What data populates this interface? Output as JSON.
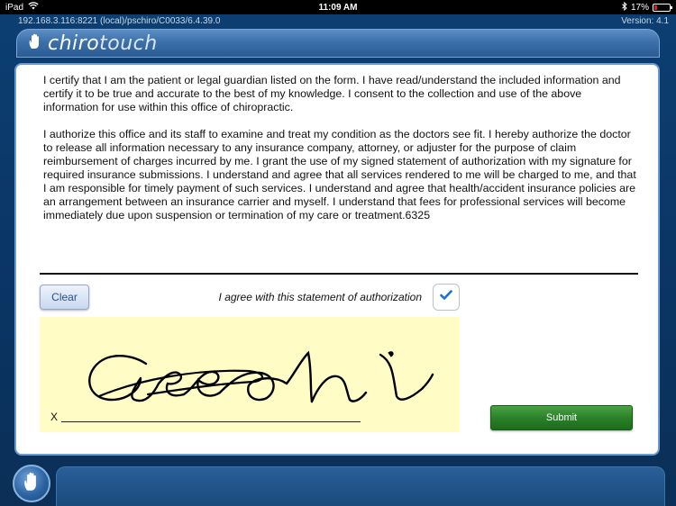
{
  "status_bar": {
    "device": "iPad",
    "time": "11:09 AM",
    "battery_percent": "17%",
    "battery_level": 0.17
  },
  "info_bar": {
    "server_path": "192.168.3.116:8221 (local)/pschiro/C0033/6.4.39.0",
    "version": "Version: 4.1"
  },
  "header": {
    "logo_chiro": "chiro",
    "logo_touch": "touch"
  },
  "statement": {
    "paragraph_1": "I certify that I am the patient or legal guardian listed on the form. I have read/understand the included information and certify it to be true and accurate to the best of my knowledge. I consent to the collection and use of the above information for use within this office of chiropractic.",
    "paragraph_2": "I authorize this office and its staff to examine and treat my condition as the doctors see fit. I hereby authorize the doctor to release all information necessary to any insurance company, attorney, or adjuster for the purpose of claim reimbursement of charges incurred by me. I grant the use of my signed statement of authorization with my signature for required insurance submissions. I understand and agree that all services rendered to me will be charged to me, and that I am responsible for timely payment of such services. I understand and agree that health/accident insurance policies are an arrangement between an insurance carrier and myself. I understand that fees for professional services will become immediately due upon suspension or termination of my care or treatment.6325"
  },
  "controls": {
    "clear_label": "Clear",
    "agree_label": "I agree with this statement of authorization",
    "agree_checked": true,
    "signature_x": "X",
    "submit_label": "Submit"
  },
  "colors": {
    "accent_blue": "#1a6fd8",
    "submit_green": "#2b8129",
    "signature_pad": "#fffcc6"
  }
}
